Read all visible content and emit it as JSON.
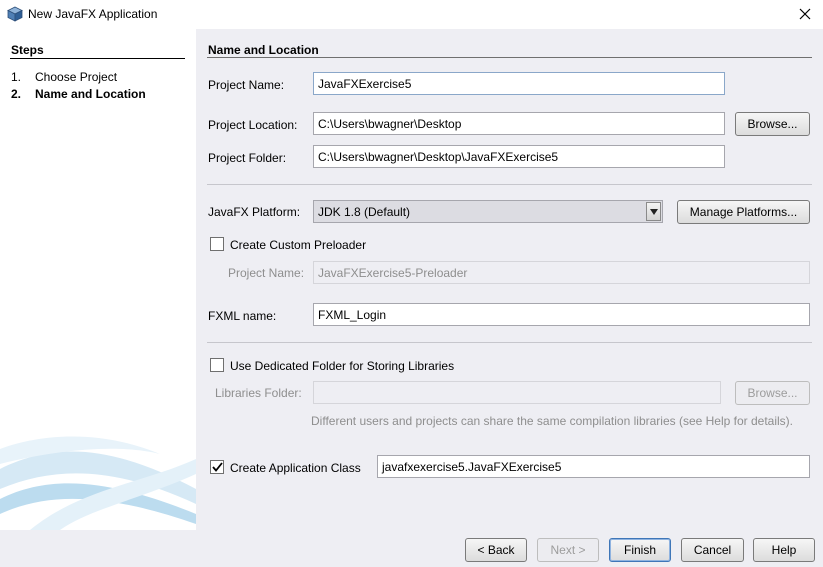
{
  "window": {
    "title": "New JavaFX Application",
    "icon": "cube-icon",
    "close_icon": "close-icon"
  },
  "steps": {
    "heading": "Steps",
    "items": [
      {
        "number": "1.",
        "label": "Choose Project",
        "current": false
      },
      {
        "number": "2.",
        "label": "Name and Location",
        "current": true
      }
    ]
  },
  "section": {
    "title": "Name and Location"
  },
  "form": {
    "project_name": {
      "label": "Project Name:",
      "value": "JavaFXExercise5"
    },
    "project_location": {
      "label": "Project Location:",
      "value": "C:\\Users\\bwagner\\Desktop"
    },
    "browse_location": "Browse...",
    "project_folder": {
      "label": "Project Folder:",
      "value": "C:\\Users\\bwagner\\Desktop\\JavaFXExercise5"
    },
    "javafx_platform": {
      "label": "JavaFX Platform:",
      "value": "JDK 1.8 (Default)"
    },
    "manage_platforms": "Manage Platforms...",
    "custom_preloader": {
      "label": "Create Custom Preloader",
      "checked": false
    },
    "preloader_name": {
      "label": "Project Name:",
      "value": "JavaFXExercise5-Preloader"
    },
    "fxml_name": {
      "label": "FXML name:",
      "value": "FXML_Login"
    },
    "dedicated_folder": {
      "label": "Use Dedicated Folder for Storing Libraries",
      "checked": false
    },
    "libraries_folder": {
      "label": "Libraries Folder:",
      "value": ""
    },
    "browse_libraries": "Browse...",
    "libraries_hint": "Different users and projects can share the same compilation libraries (see Help for details).",
    "create_app_class": {
      "label": "Create Application Class",
      "checked": true,
      "value": "javafxexercise5.JavaFXExercise5"
    }
  },
  "buttons": {
    "back": "< Back",
    "next": "Next >",
    "finish": "Finish",
    "cancel": "Cancel",
    "help": "Help"
  },
  "colors": {
    "panel_bg": "#eeeef3",
    "primary_border": "#3f76b8"
  }
}
